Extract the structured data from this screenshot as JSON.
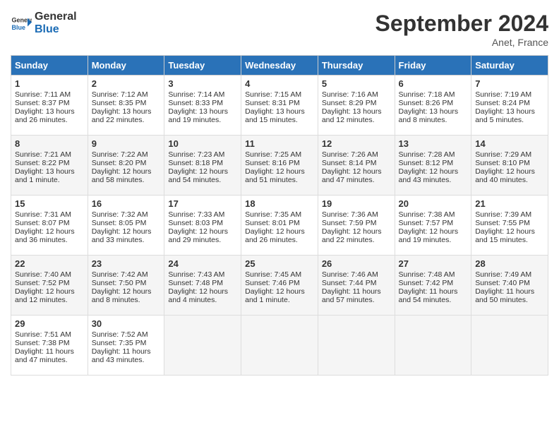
{
  "header": {
    "logo_text_general": "General",
    "logo_text_blue": "Blue",
    "month_title": "September 2024",
    "location": "Anet, France"
  },
  "days_of_week": [
    "Sunday",
    "Monday",
    "Tuesday",
    "Wednesday",
    "Thursday",
    "Friday",
    "Saturday"
  ],
  "weeks": [
    [
      {
        "day": "1",
        "info": "Sunrise: 7:11 AM\nSunset: 8:37 PM\nDaylight: 13 hours\nand 26 minutes."
      },
      {
        "day": "2",
        "info": "Sunrise: 7:12 AM\nSunset: 8:35 PM\nDaylight: 13 hours\nand 22 minutes."
      },
      {
        "day": "3",
        "info": "Sunrise: 7:14 AM\nSunset: 8:33 PM\nDaylight: 13 hours\nand 19 minutes."
      },
      {
        "day": "4",
        "info": "Sunrise: 7:15 AM\nSunset: 8:31 PM\nDaylight: 13 hours\nand 15 minutes."
      },
      {
        "day": "5",
        "info": "Sunrise: 7:16 AM\nSunset: 8:29 PM\nDaylight: 13 hours\nand 12 minutes."
      },
      {
        "day": "6",
        "info": "Sunrise: 7:18 AM\nSunset: 8:26 PM\nDaylight: 13 hours\nand 8 minutes."
      },
      {
        "day": "7",
        "info": "Sunrise: 7:19 AM\nSunset: 8:24 PM\nDaylight: 13 hours\nand 5 minutes."
      }
    ],
    [
      {
        "day": "8",
        "info": "Sunrise: 7:21 AM\nSunset: 8:22 PM\nDaylight: 13 hours\nand 1 minute."
      },
      {
        "day": "9",
        "info": "Sunrise: 7:22 AM\nSunset: 8:20 PM\nDaylight: 12 hours\nand 58 minutes."
      },
      {
        "day": "10",
        "info": "Sunrise: 7:23 AM\nSunset: 8:18 PM\nDaylight: 12 hours\nand 54 minutes."
      },
      {
        "day": "11",
        "info": "Sunrise: 7:25 AM\nSunset: 8:16 PM\nDaylight: 12 hours\nand 51 minutes."
      },
      {
        "day": "12",
        "info": "Sunrise: 7:26 AM\nSunset: 8:14 PM\nDaylight: 12 hours\nand 47 minutes."
      },
      {
        "day": "13",
        "info": "Sunrise: 7:28 AM\nSunset: 8:12 PM\nDaylight: 12 hours\nand 43 minutes."
      },
      {
        "day": "14",
        "info": "Sunrise: 7:29 AM\nSunset: 8:10 PM\nDaylight: 12 hours\nand 40 minutes."
      }
    ],
    [
      {
        "day": "15",
        "info": "Sunrise: 7:31 AM\nSunset: 8:07 PM\nDaylight: 12 hours\nand 36 minutes."
      },
      {
        "day": "16",
        "info": "Sunrise: 7:32 AM\nSunset: 8:05 PM\nDaylight: 12 hours\nand 33 minutes."
      },
      {
        "day": "17",
        "info": "Sunrise: 7:33 AM\nSunset: 8:03 PM\nDaylight: 12 hours\nand 29 minutes."
      },
      {
        "day": "18",
        "info": "Sunrise: 7:35 AM\nSunset: 8:01 PM\nDaylight: 12 hours\nand 26 minutes."
      },
      {
        "day": "19",
        "info": "Sunrise: 7:36 AM\nSunset: 7:59 PM\nDaylight: 12 hours\nand 22 minutes."
      },
      {
        "day": "20",
        "info": "Sunrise: 7:38 AM\nSunset: 7:57 PM\nDaylight: 12 hours\nand 19 minutes."
      },
      {
        "day": "21",
        "info": "Sunrise: 7:39 AM\nSunset: 7:55 PM\nDaylight: 12 hours\nand 15 minutes."
      }
    ],
    [
      {
        "day": "22",
        "info": "Sunrise: 7:40 AM\nSunset: 7:52 PM\nDaylight: 12 hours\nand 12 minutes."
      },
      {
        "day": "23",
        "info": "Sunrise: 7:42 AM\nSunset: 7:50 PM\nDaylight: 12 hours\nand 8 minutes."
      },
      {
        "day": "24",
        "info": "Sunrise: 7:43 AM\nSunset: 7:48 PM\nDaylight: 12 hours\nand 4 minutes."
      },
      {
        "day": "25",
        "info": "Sunrise: 7:45 AM\nSunset: 7:46 PM\nDaylight: 12 hours\nand 1 minute."
      },
      {
        "day": "26",
        "info": "Sunrise: 7:46 AM\nSunset: 7:44 PM\nDaylight: 11 hours\nand 57 minutes."
      },
      {
        "day": "27",
        "info": "Sunrise: 7:48 AM\nSunset: 7:42 PM\nDaylight: 11 hours\nand 54 minutes."
      },
      {
        "day": "28",
        "info": "Sunrise: 7:49 AM\nSunset: 7:40 PM\nDaylight: 11 hours\nand 50 minutes."
      }
    ],
    [
      {
        "day": "29",
        "info": "Sunrise: 7:51 AM\nSunset: 7:38 PM\nDaylight: 11 hours\nand 47 minutes."
      },
      {
        "day": "30",
        "info": "Sunrise: 7:52 AM\nSunset: 7:35 PM\nDaylight: 11 hours\nand 43 minutes."
      },
      {
        "day": "",
        "info": ""
      },
      {
        "day": "",
        "info": ""
      },
      {
        "day": "",
        "info": ""
      },
      {
        "day": "",
        "info": ""
      },
      {
        "day": "",
        "info": ""
      }
    ]
  ]
}
